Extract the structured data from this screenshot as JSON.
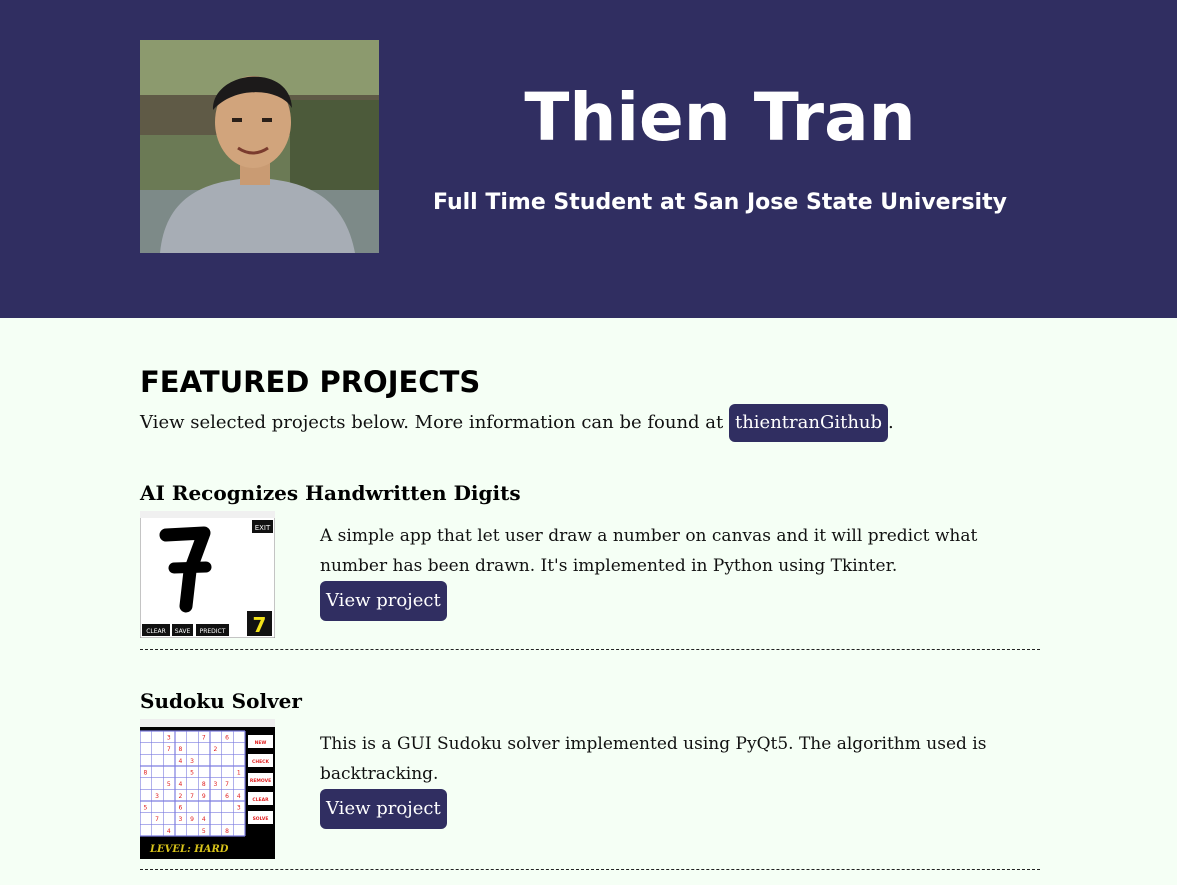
{
  "header": {
    "name": "Thien Tran",
    "subtitle": "Full Time Student at San Jose State University",
    "bg_color": "#302e61"
  },
  "featured": {
    "title": "FEATURED PROJECTS",
    "intro_before": "View selected projects below. More information can be found at ",
    "github_link": "thientranGithub",
    "intro_after": "."
  },
  "projects": [
    {
      "title": "AI Recognizes Handwritten Digits",
      "description": "A simple app that let user draw a number on canvas and it will predict what number has been drawn. It's implemented in Python using Tkinter.",
      "button": "View project",
      "thumb": {
        "exit": "EXIT",
        "digit": "7",
        "buttons": [
          "CLEAR",
          "SAVE",
          "PREDICT"
        ],
        "prediction": "7"
      }
    },
    {
      "title": "Sudoku Solver",
      "description": "This is a GUI Sudoku solver implemented using PyQt5. The algorithm used is backtracking.",
      "button": "View project",
      "thumb": {
        "buttons": [
          "NEW",
          "CHECK",
          "REMOVE",
          "CLEAR",
          "SOLVE"
        ],
        "level": "LEVEL: HARD"
      }
    }
  ]
}
